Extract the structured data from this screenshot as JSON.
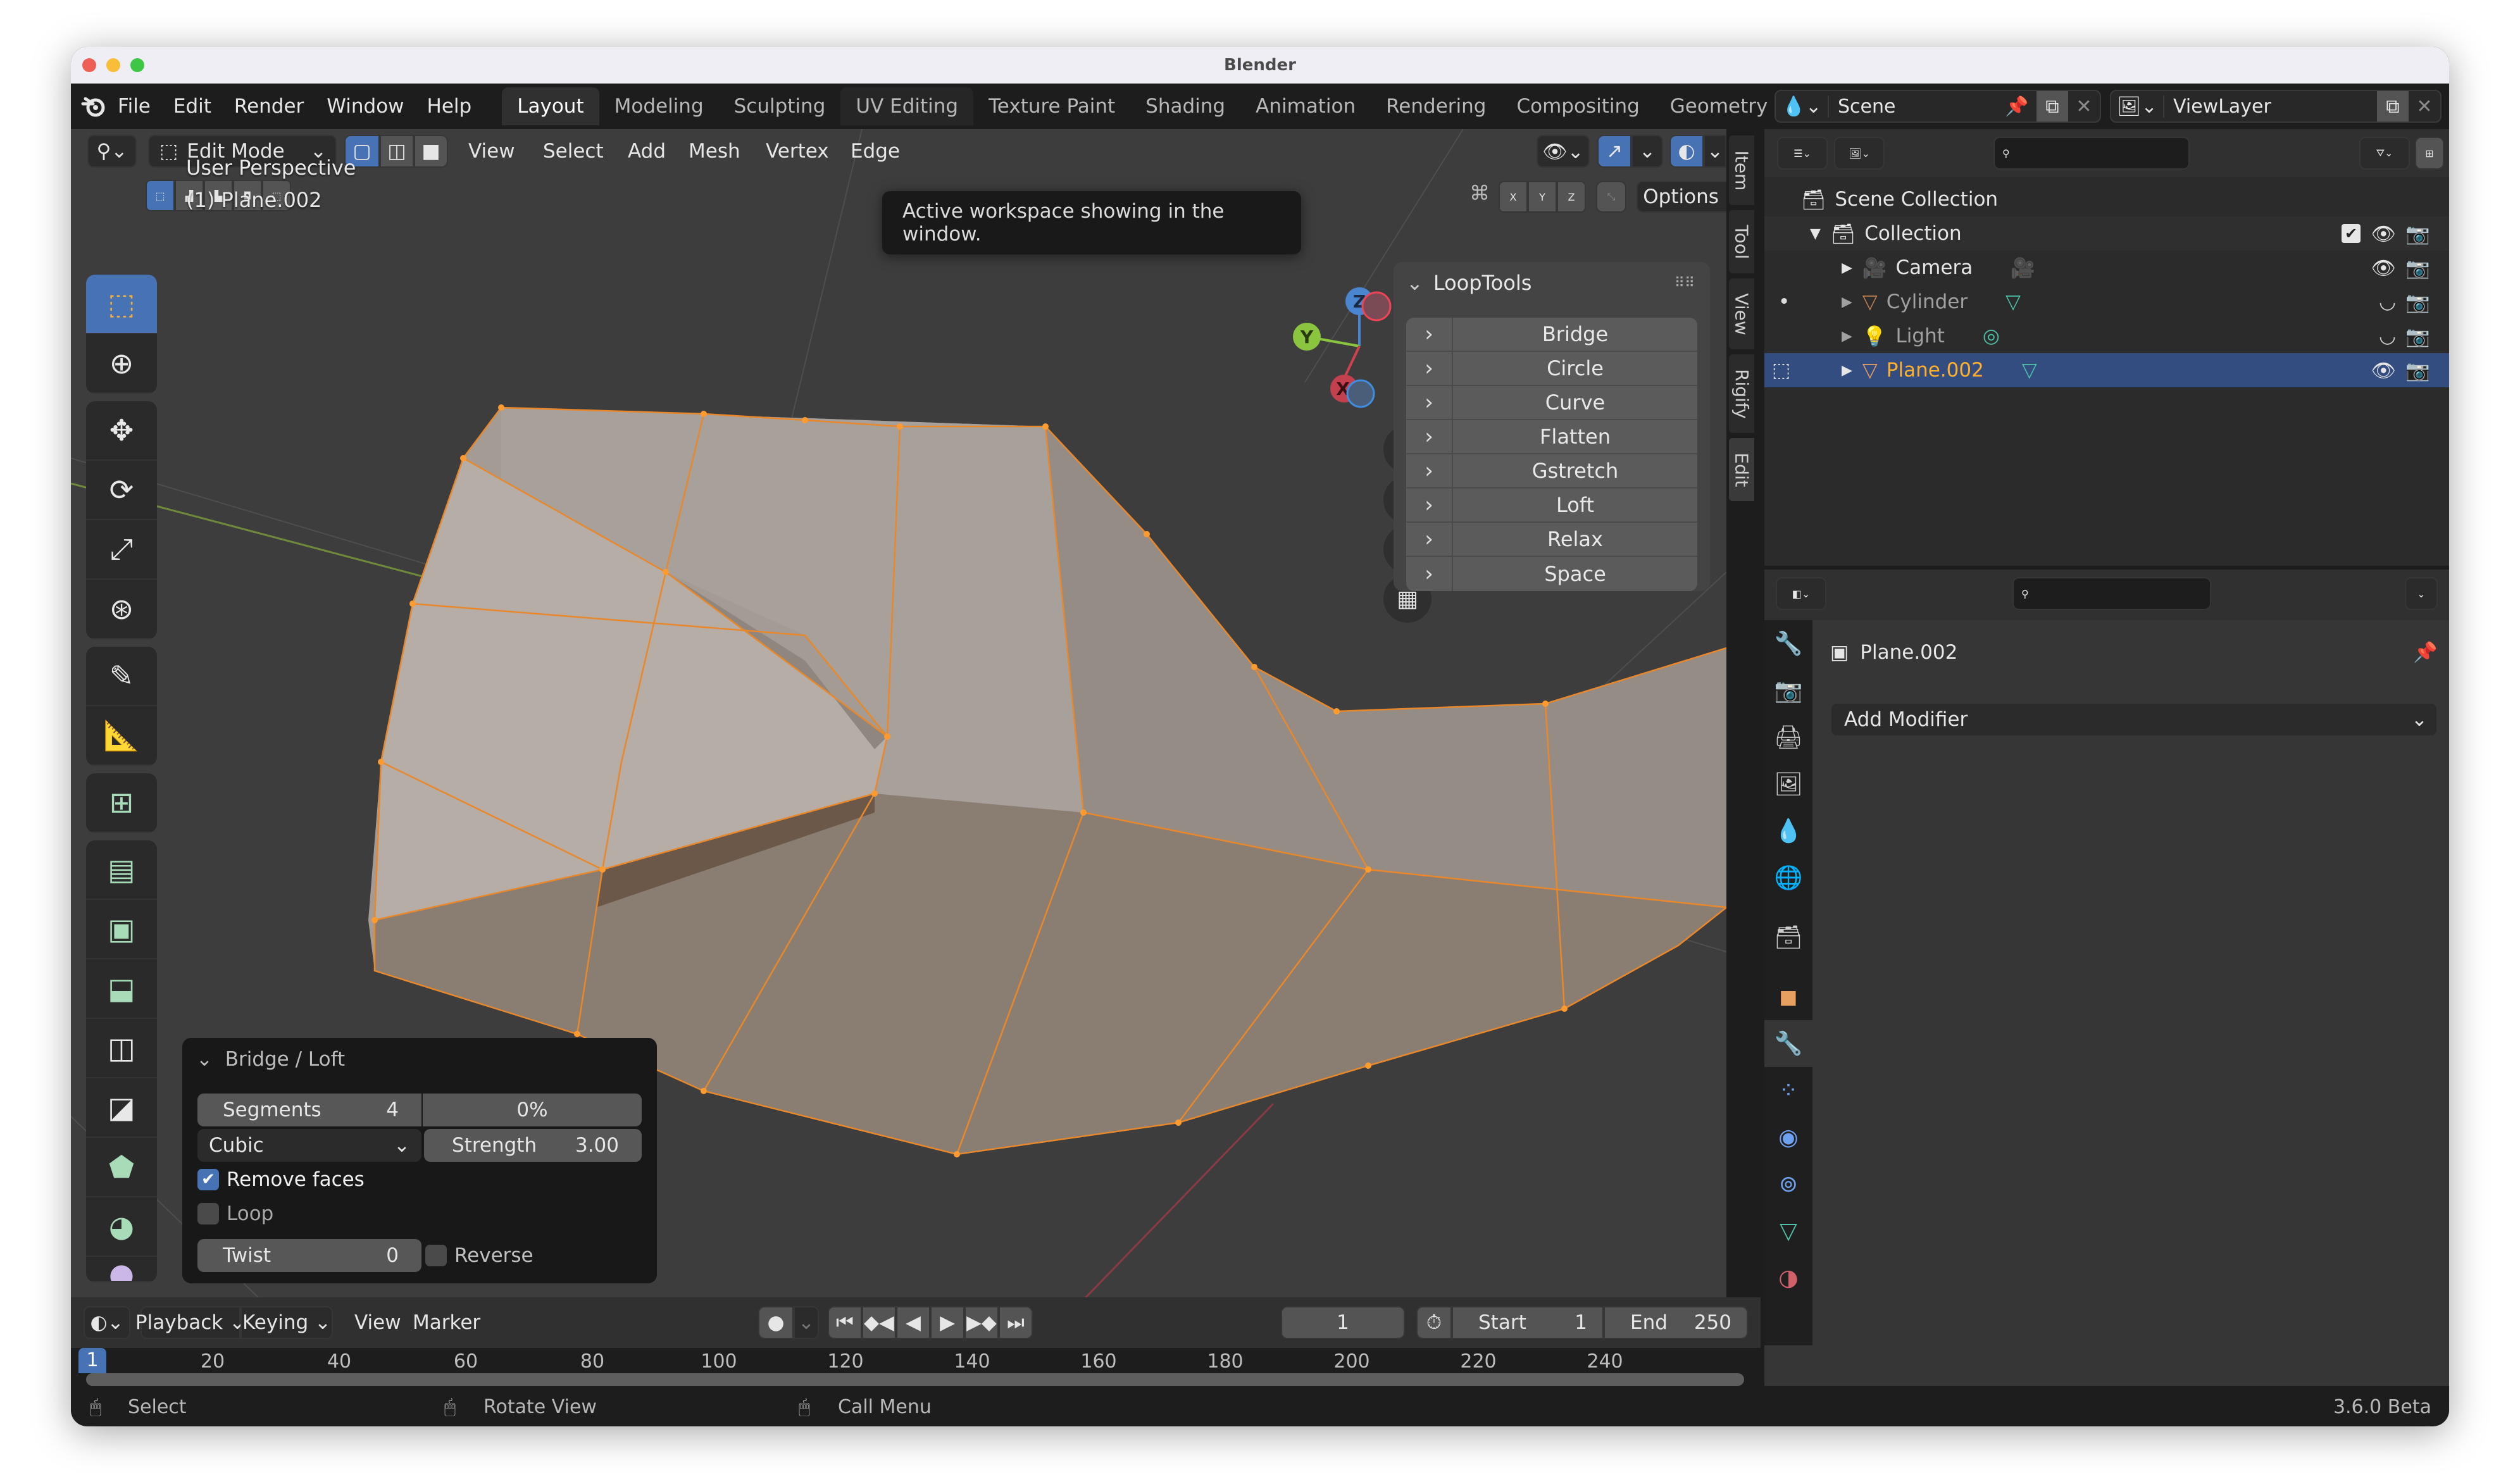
{
  "window": {
    "title": "Blender",
    "traffic_colors": [
      "#ee5f58",
      "#f8be3a",
      "#3ec746"
    ]
  },
  "topbar": {
    "menus": [
      "File",
      "Edit",
      "Render",
      "Window",
      "Help"
    ],
    "workspaces": [
      {
        "label": "Layout",
        "active": true
      },
      {
        "label": "Modeling",
        "active": false
      },
      {
        "label": "Sculpting",
        "active": false
      },
      {
        "label": "UV Editing",
        "active": false
      },
      {
        "label": "Texture Paint",
        "active": false
      },
      {
        "label": "Shading",
        "active": false
      },
      {
        "label": "Animation",
        "active": false
      },
      {
        "label": "Rendering",
        "active": false
      },
      {
        "label": "Compositing",
        "active": false
      },
      {
        "label": "Geometry",
        "active": false
      }
    ],
    "scene": "Scene",
    "view_layer": "ViewLayer"
  },
  "viewport_header": {
    "mode": "Edit Mode",
    "menus": [
      "View",
      "Select",
      "Add",
      "Mesh",
      "Vertex",
      "Edge"
    ],
    "options_label": "Options",
    "axes": [
      "X",
      "Y",
      "Z"
    ]
  },
  "tooltip": {
    "text": "Active workspace showing in the window."
  },
  "viewport": {
    "perspective": "User Perspective",
    "object_label": "(1) Plane.002",
    "gizmo_axes": [
      "X",
      "Y",
      "Z"
    ],
    "nav_buttons": [
      "zoom-icon",
      "pan-hand-icon",
      "camera-icon",
      "grid-icon"
    ]
  },
  "tools": [
    "select-box",
    "cursor",
    "move",
    "rotate",
    "scale",
    "transform",
    "annotate",
    "measure",
    "add-cube",
    "extrude",
    "inset",
    "bevel",
    "loop-cut",
    "knife",
    "poly-build",
    "spin",
    "smooth"
  ],
  "looptools": {
    "title": "LoopTools",
    "items": [
      "Bridge",
      "Circle",
      "Curve",
      "Flatten",
      "Gstretch",
      "Loft",
      "Relax",
      "Space"
    ]
  },
  "n_panel_tabs": [
    "Item",
    "Tool",
    "View",
    "Rigify",
    "Edit"
  ],
  "last_operator": {
    "title": "Bridge / Loft",
    "segments_label": "Segments",
    "segments_value": "4",
    "percent_value": "0%",
    "interpolation": "Cubic",
    "strength_label": "Strength",
    "strength_value": "3.00",
    "remove_faces_label": "Remove faces",
    "remove_faces_checked": true,
    "loop_label": "Loop",
    "loop_checked": false,
    "twist_label": "Twist",
    "twist_value": "0",
    "reverse_label": "Reverse",
    "reverse_checked": false
  },
  "timeline": {
    "menus": [
      "Playback",
      "Keying",
      "View",
      "Marker"
    ],
    "current_frame": "1",
    "start_label": "Start",
    "start_value": "1",
    "end_label": "End",
    "end_value": "250",
    "ruler_marks": [
      "20",
      "40",
      "60",
      "80",
      "100",
      "120",
      "140",
      "160",
      "180",
      "200",
      "220",
      "240"
    ],
    "playhead": "1"
  },
  "statusbar": {
    "hints": [
      "Select",
      "Rotate View",
      "Call Menu"
    ],
    "version": "3.6.0 Beta"
  },
  "outliner": {
    "root": "Scene Collection",
    "collection": "Collection",
    "items": [
      {
        "name": "Camera",
        "type": "camera",
        "visible": true
      },
      {
        "name": "Cylinder",
        "type": "mesh",
        "visible": false
      },
      {
        "name": "Light",
        "type": "light",
        "visible": false
      },
      {
        "name": "Plane.002",
        "type": "mesh",
        "visible": true,
        "selected": true
      }
    ]
  },
  "properties": {
    "object_name": "Plane.002",
    "add_modifier_label": "Add Modifier",
    "tabs": [
      "tool",
      "render",
      "output",
      "view-layer",
      "scene",
      "world",
      "collection",
      "object",
      "modifiers",
      "particles",
      "physics",
      "constraints",
      "data",
      "material"
    ],
    "active_tab": "modifiers"
  },
  "colors": {
    "accent": "#4772b3",
    "selected_text": "#ffaf29",
    "mesh_edge": "#e8882a"
  }
}
